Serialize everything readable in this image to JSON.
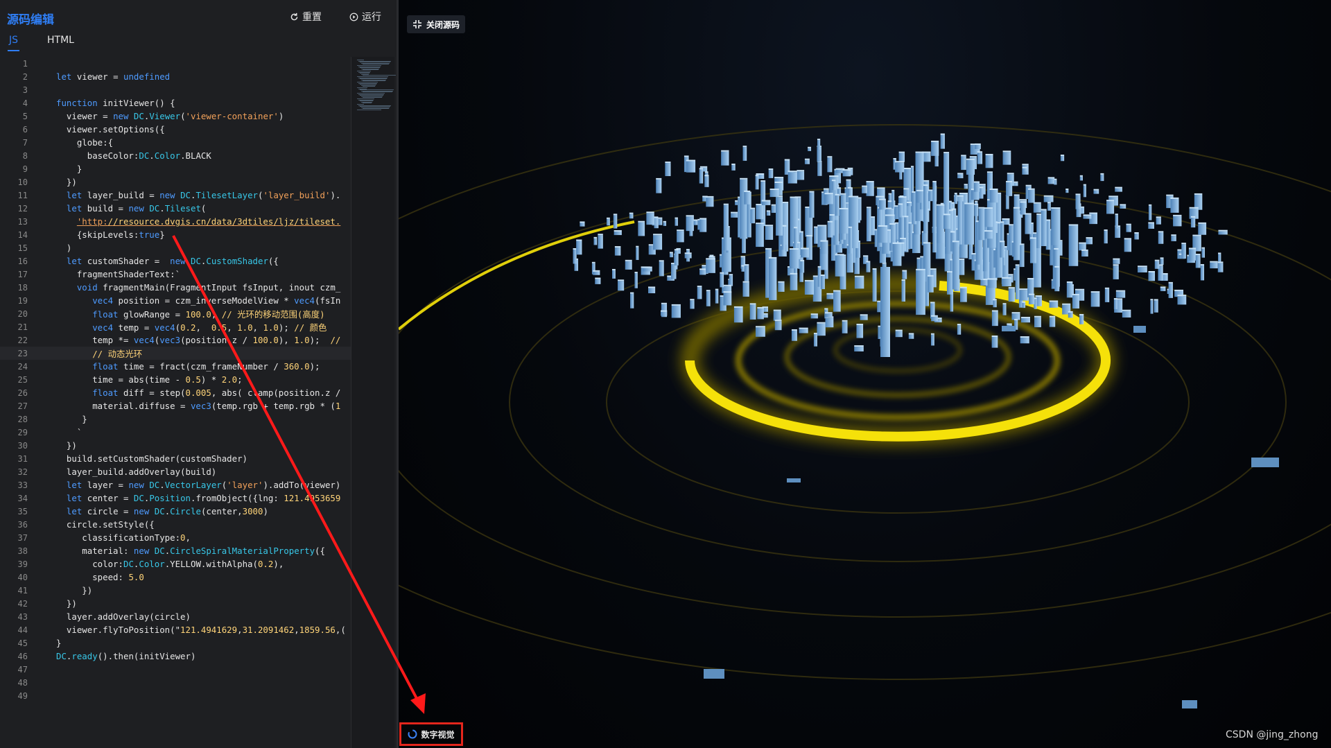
{
  "editor": {
    "title": "源码编辑",
    "reset_label": "重置",
    "run_label": "运行",
    "tabs": [
      {
        "label": "JS"
      },
      {
        "label": "HTML"
      }
    ]
  },
  "code_lines": [
    "",
    "let viewer = undefined",
    "",
    "function initViewer() {",
    "  viewer = new DC.Viewer('viewer-container')",
    "  viewer.setOptions({",
    "    globe:{",
    "      baseColor:DC.Color.BLACK",
    "    }",
    "  })",
    "  let layer_build = new DC.TilesetLayer('layer_build').",
    "  let build = new DC.Tileset(",
    "    'http://resource.dvgis.cn/data/3dtiles/ljz/tileset.",
    "    {skipLevels:true}",
    "  )",
    "  let customShader =  new DC.CustomShader({",
    "    fragmentShaderText:`",
    "    void fragmentMain(FragmentInput fsInput, inout czm_",
    "       vec4 position = czm_inverseModelView * vec4(fsIn",
    "       float glowRange = 100.0; // 光环的移动范围(高度)",
    "       vec4 temp = vec4(0.2,  0.5, 1.0, 1.0); // 颜色",
    "       temp *= vec4(vec3(position.z / 100.0), 1.0);  //",
    "       // 动态光环",
    "       float time = fract(czm_frameNumber / 360.0);",
    "       time = abs(time - 0.5) * 2.0;",
    "       float diff = step(0.005, abs( clamp(position.z /",
    "       material.diffuse = vec3(temp.rgb + temp.rgb * (1",
    "     }",
    "    `",
    "  })",
    "  build.setCustomShader(customShader)",
    "  layer_build.addOverlay(build)",
    "  let layer = new DC.VectorLayer('layer').addTo(viewer)",
    "  let center = DC.Position.fromObject({lng: 121.4953659",
    "  let circle = new DC.Circle(center,3000)",
    "  circle.setStyle({",
    "     classificationType:0,",
    "     material: new DC.CircleSpiralMaterialProperty({",
    "       color:DC.Color.YELLOW.withAlpha(0.2),",
    "       speed: 5.0",
    "     })",
    "  })",
    "  layer.addOverlay(circle)",
    "  viewer.flyToPosition(\"121.4941629,31.2091462,1859.56,(",
    "}",
    "DC.ready().then(initViewer)",
    "",
    "",
    ""
  ],
  "viewer": {
    "close_source_label": "关闭源码",
    "logo_text": "数字视觉",
    "watermark": "CSDN @jing_zhong"
  },
  "colors": {
    "accent": "#2f7ef5",
    "ring": "#f5e10a",
    "building": "#6fa6d6",
    "highlight_box": "#e4261c"
  }
}
